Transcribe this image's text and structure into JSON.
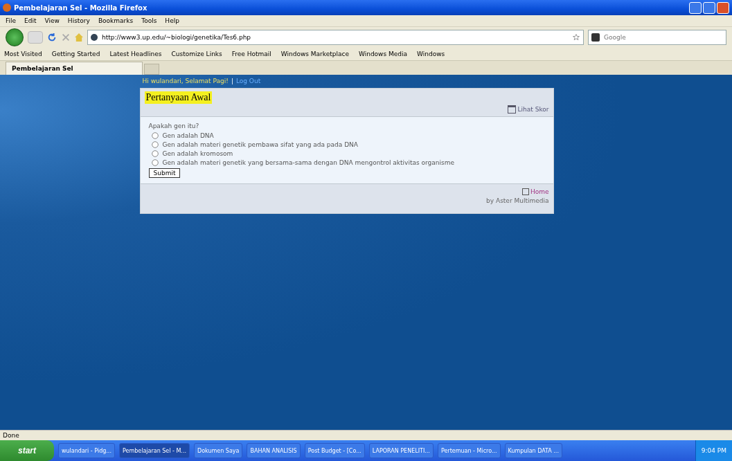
{
  "window": {
    "title": "Pembelajaran Sel - Mozilla Firefox"
  },
  "menu": [
    "File",
    "Edit",
    "View",
    "History",
    "Bookmarks",
    "Tools",
    "Help"
  ],
  "address": {
    "value": "http://www3.up.edu/~biologi/genetika/Tes6.php"
  },
  "search": {
    "placeholder": "Google"
  },
  "bookmarks": [
    "Most Visited",
    "Getting Started",
    "Latest Headlines",
    "Customize Links",
    "Free Hotmail",
    "Windows Marketplace",
    "Windows Media",
    "Windows"
  ],
  "tabs": [
    {
      "label": "Pembelajaran Sel",
      "selected": true
    }
  ],
  "page": {
    "greeting": "Hi wulandari, Selamat Pagi!",
    "separator": "|",
    "logout": "Log Out",
    "card": {
      "title": "Pertanyaan Awal",
      "score_link": "Lihat Skor",
      "question": "Apakah gen itu?",
      "options": [
        {
          "label": "Gen adalah DNA",
          "selected": false
        },
        {
          "label": "Gen adalah materi genetik pembawa sifat yang ada pada DNA",
          "selected": false
        },
        {
          "label": "Gen adalah kromosom",
          "selected": false
        },
        {
          "label": "Gen adalah materi genetik yang bersama-sama dengan DNA mengontrol aktivitas organisme",
          "selected": false
        }
      ],
      "submit": "Submit",
      "home": "Home",
      "credit": "by Aster Multimedia"
    }
  },
  "status_bar": "Done",
  "taskbar": {
    "start": "start",
    "items": [
      {
        "label": "wulandari - Pidg...",
        "selected": false
      },
      {
        "label": "Pembelajaran Sel - M...",
        "selected": true
      },
      {
        "label": "Dokumen Saya",
        "selected": false
      },
      {
        "label": "BAHAN ANALISIS",
        "selected": false
      },
      {
        "label": "Post Budget - [Co...",
        "selected": false
      },
      {
        "label": "LAPORAN PENELITI...",
        "selected": false
      },
      {
        "label": "Pertemuan - Micro...",
        "selected": false
      },
      {
        "label": "Kumpulan DATA ...",
        "selected": false
      }
    ],
    "clock": "9:04 PM"
  }
}
